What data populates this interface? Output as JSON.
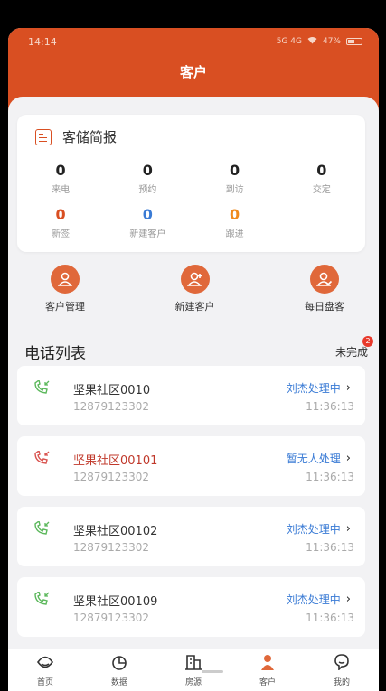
{
  "status_bar": {
    "time": "14:14",
    "signal": "5G 4G",
    "battery": "47%"
  },
  "header": {
    "title": "客户"
  },
  "brief": {
    "title": "客储简报",
    "row1": [
      {
        "value": "0",
        "label": "来电",
        "color": "#222222"
      },
      {
        "value": "0",
        "label": "预约",
        "color": "#222222"
      },
      {
        "value": "0",
        "label": "到访",
        "color": "#222222"
      },
      {
        "value": "0",
        "label": "交定",
        "color": "#222222"
      }
    ],
    "row2": [
      {
        "value": "0",
        "label": "新签",
        "color": "#d94f22"
      },
      {
        "value": "0",
        "label": "新建客户",
        "color": "#3a7bd5"
      },
      {
        "value": "0",
        "label": "跟进",
        "color": "#f08a1c"
      }
    ]
  },
  "quick_actions": [
    {
      "label": "客户管理",
      "icon": "user-icon"
    },
    {
      "label": "新建客户",
      "icon": "user-add-icon"
    },
    {
      "label": "每日盘客",
      "icon": "user-check-icon"
    }
  ],
  "calls": {
    "title": "电话列表",
    "filter": "未完成",
    "badge": "2",
    "items": [
      {
        "name": "坚果社区0010",
        "phone": "12879123302",
        "status": "刘杰处理中",
        "time": "11:36:13",
        "missed": false
      },
      {
        "name": "坚果社区00101",
        "phone": "12879123302",
        "status": "暂无人处理",
        "time": "11:36:13",
        "missed": true
      },
      {
        "name": "坚果社区00102",
        "phone": "12879123302",
        "status": "刘杰处理中",
        "time": "11:36:13",
        "missed": false
      },
      {
        "name": "坚果社区00109",
        "phone": "12879123302",
        "status": "刘杰处理中",
        "time": "11:36:13",
        "missed": false
      }
    ]
  },
  "tabbar": [
    {
      "label": "首页",
      "icon": "home-icon"
    },
    {
      "label": "数据",
      "icon": "pie-chart-icon"
    },
    {
      "label": "房源",
      "icon": "building-icon"
    },
    {
      "label": "客户",
      "icon": "customer-icon"
    },
    {
      "label": "我的",
      "icon": "profile-icon"
    }
  ],
  "colors": {
    "brand": "#d94f22",
    "link": "#3a7bd5",
    "answered": "#5cb85c",
    "missed": "#d9534f"
  }
}
